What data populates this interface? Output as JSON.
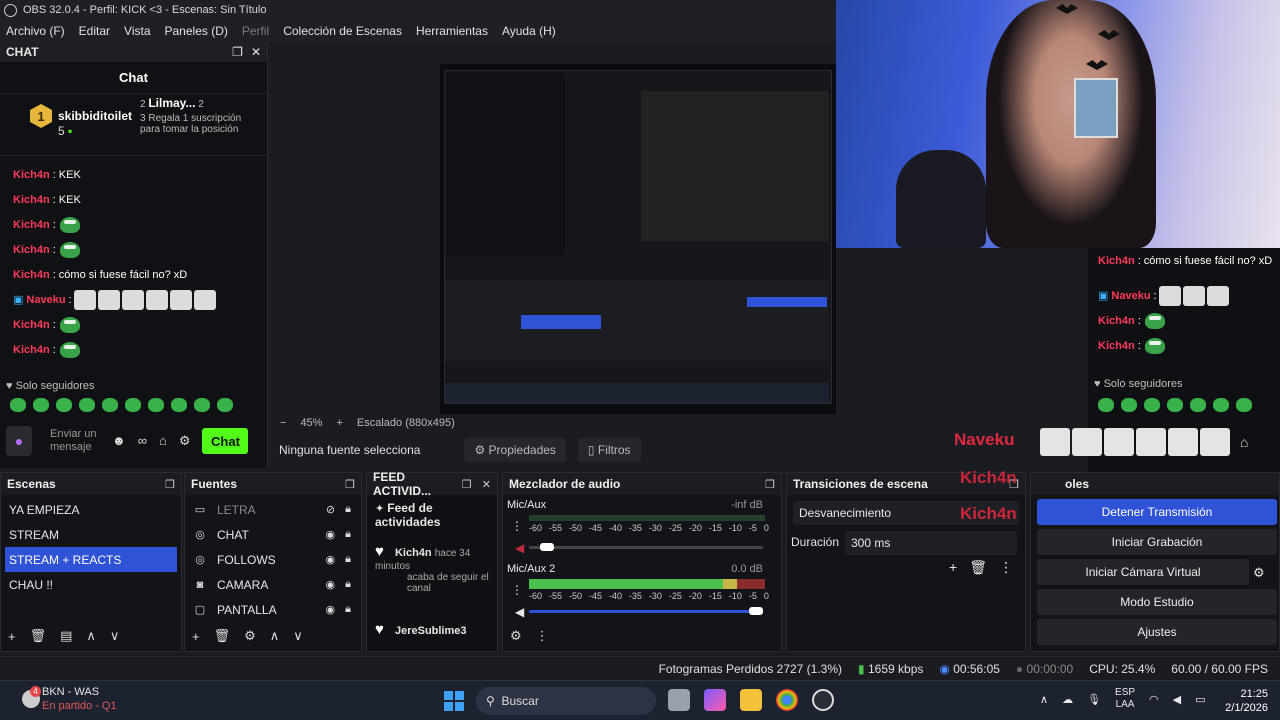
{
  "window": {
    "title": "OBS 32.0.4 - Perfil: KICK <3 - Escenas: Sin Título"
  },
  "menu": [
    "Archivo (F)",
    "Editar",
    "Vista",
    "Paneles (D)",
    "Perfil",
    "Colección de Escenas",
    "Herramientas",
    "Ayuda (H)"
  ],
  "chat_dock": {
    "title": "CHAT",
    "header": "Chat",
    "leaderboard": {
      "first_rank": "1",
      "first_name": "skibbiditoilet",
      "first_count": "5",
      "second_rank": "2",
      "second_name": "Lilmay...",
      "second_count": "2",
      "third_rank": "3",
      "third_text": "Regala 1 suscripción para tomar la posición"
    },
    "messages": [
      {
        "user": "Kich4n",
        "text": ": KEK"
      },
      {
        "user": "Kich4n",
        "text": ": KEK"
      },
      {
        "user": "Kich4n",
        "text": ":"
      },
      {
        "user": "Kich4n",
        "text": ":"
      },
      {
        "user": "Kich4n",
        "text": ": cómo si fuese fácil no? xD"
      },
      {
        "user": "Naveku",
        "text": ":"
      },
      {
        "user": "Kich4n",
        "text": ":"
      },
      {
        "user": "Kich4n",
        "text": ":"
      }
    ],
    "followers_label": "Solo seguidores",
    "input_placeholder": "Enviar un mensaje",
    "send_button": "Chat"
  },
  "preview": {
    "zoom": "45%",
    "scaling": "Escalado (880x495)",
    "no_source": "Ninguna fuente selecciona",
    "properties": "Propiedades",
    "filters": "Filtros"
  },
  "overlay": {
    "messages": [
      {
        "user": "Kich4n",
        "text": ": cómo si fuese fácil no? xD"
      },
      {
        "user": "Naveku",
        "text": ":"
      },
      {
        "user": "Kich4n",
        "text": ":"
      },
      {
        "user": "Kich4n",
        "text": ":"
      }
    ],
    "followers_label": "Solo seguidores",
    "naveku": "Naveku",
    "kich_1": "Kich4n",
    "kich_2": "Kich4n",
    "controls_fragment": "oles"
  },
  "scenes": {
    "title": "Escenas",
    "items": [
      "YA EMPIEZA",
      "STREAM",
      "STREAM + REACTS",
      "CHAU !!"
    ],
    "selected": "STREAM + REACTS"
  },
  "sources": {
    "title": "Fuentes",
    "items": [
      "LETRA",
      "CHAT",
      "FOLLOWS",
      "CAMARA",
      "PANTALLA"
    ]
  },
  "feed": {
    "title": "FEED ACTIVID...",
    "subtitle": "Feed de actividades",
    "item1_name": "Kich4n",
    "item1_time": "hace 34 minutos",
    "item1_action": "acaba de seguir el canal",
    "item2_name": "JereSublime3"
  },
  "mixer": {
    "title": "Mezclador de audio",
    "tracks": [
      {
        "name": "Mic/Aux",
        "level": "-inf dB",
        "meter_fraction": 0.0,
        "volume_fraction": 0.05
      },
      {
        "name": "Mic/Aux 2",
        "level": "0.0 dB",
        "meter_fraction": 0.82,
        "volume_fraction": 1.0
      }
    ],
    "scale": [
      "-60",
      "-55",
      "-50",
      "-45",
      "-40",
      "-35",
      "-30",
      "-25",
      "-20",
      "-15",
      "-10",
      "-5",
      "0"
    ]
  },
  "transitions": {
    "title": "Transiciones de escena",
    "type": "Desvanecimiento",
    "duration_label": "Duración",
    "duration_value": "300 ms"
  },
  "controls": {
    "stop_stream": "Detener Transmisión",
    "start_record": "Iniciar Grabación",
    "virtual_cam": "Iniciar Cámara Virtual",
    "studio_mode": "Modo Estudio",
    "settings": "Ajustes"
  },
  "status": {
    "dropped_frames": "Fotogramas Perdidos 2727 (1.3%)",
    "bitrate": "1659 kbps",
    "stream_time": "00:56:05",
    "record_time": "00:00:00",
    "cpu": "CPU: 25.4%",
    "fps": "60.00 / 60.00 FPS"
  },
  "taskbar": {
    "profile_badge": "4",
    "profile_name": "BKN - WAS",
    "profile_status": "En partido - Q1",
    "search": "Buscar",
    "lang_top": "ESP",
    "lang_bottom": "LAA",
    "time": "21:25",
    "date": "2/1/2026"
  },
  "colors": {
    "accent": "#2f53d6",
    "kick_green": "#53fc18",
    "username_red": "#ff3b5b"
  }
}
